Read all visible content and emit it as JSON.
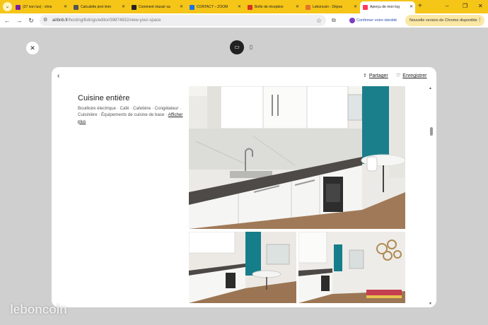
{
  "browser": {
    "tabs": [
      {
        "label": "(37 non lus) - chris",
        "favicon_color": "#7b1fa2",
        "active": false
      },
      {
        "label": "Calculette pret imm",
        "favicon_color": "#555555",
        "active": false
      },
      {
        "label": "Comment réussir sa",
        "favicon_color": "#222222",
        "active": false
      },
      {
        "label": "CONTACT – ZOOM",
        "favicon_color": "#1a73e8",
        "active": false
      },
      {
        "label": "Boîte de réception",
        "favicon_color": "#d93025",
        "active": false
      },
      {
        "label": "Leboncoin - Dépos",
        "favicon_color": "#e8702a",
        "active": false
      },
      {
        "label": "Aperçu de mon log",
        "favicon_color": "#ff385c",
        "active": true
      }
    ],
    "new_tab_symbol": "+",
    "window_controls": {
      "menu": "⌄",
      "minimize": "–",
      "restore": "❐",
      "close": "✕"
    },
    "url_domain": "airbnb.fr",
    "url_path": "/hosting/listings/editor/39874832/view-your-space",
    "identity_label": "Confirmer votre identité",
    "update_label": "Nouvelle version de Chrome disponible"
  },
  "listing": {
    "back_symbol": "‹",
    "share_label": "Partager",
    "save_label": "Enregistrer",
    "section_title": "Cuisine entière",
    "amenities_text": "Bouilloire électrique · Café · Cafetière · Congélateur · Cuisinière · Équipements de cuisine de base ·",
    "show_more_label": "Afficher plus"
  },
  "watermark": "leboncoin",
  "colors": {
    "accent": "#ff385c",
    "chrome_tabstrip": "#f5c518"
  }
}
